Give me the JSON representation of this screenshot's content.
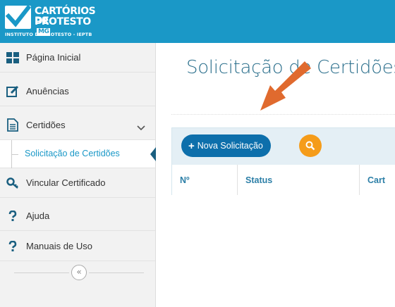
{
  "brand": {
    "line1": "CARTÓRIOS DE",
    "line2": "PROTESTO",
    "badge": "MG",
    "line3": "INSTITUTO DE PROTESTO - IEPTB"
  },
  "sidebar": {
    "items": [
      {
        "label": "Página Inicial",
        "icon": "grid-icon"
      },
      {
        "label": "Anuências",
        "icon": "edit-icon"
      },
      {
        "label": "Certidões",
        "icon": "document-icon"
      },
      {
        "label": "Vincular Certificado",
        "icon": "key-icon"
      },
      {
        "label": "Ajuda",
        "icon": "question-icon"
      },
      {
        "label": "Manuais de Uso",
        "icon": "question-icon"
      }
    ],
    "sub_item": {
      "label": "Solicitação de Certidões"
    },
    "collapse_symbol": "«"
  },
  "main": {
    "title": "Solicitação de Certidões",
    "new_button": {
      "plus": "+",
      "label": "Nova Solicitação"
    },
    "table": {
      "columns": [
        "Nº",
        "Status",
        "Cart"
      ]
    }
  },
  "colors": {
    "brand_blue": "#1a98c7",
    "primary_button": "#0d6fab",
    "search_button": "#f59c1a",
    "annotation_arrow": "#e06a2e"
  }
}
